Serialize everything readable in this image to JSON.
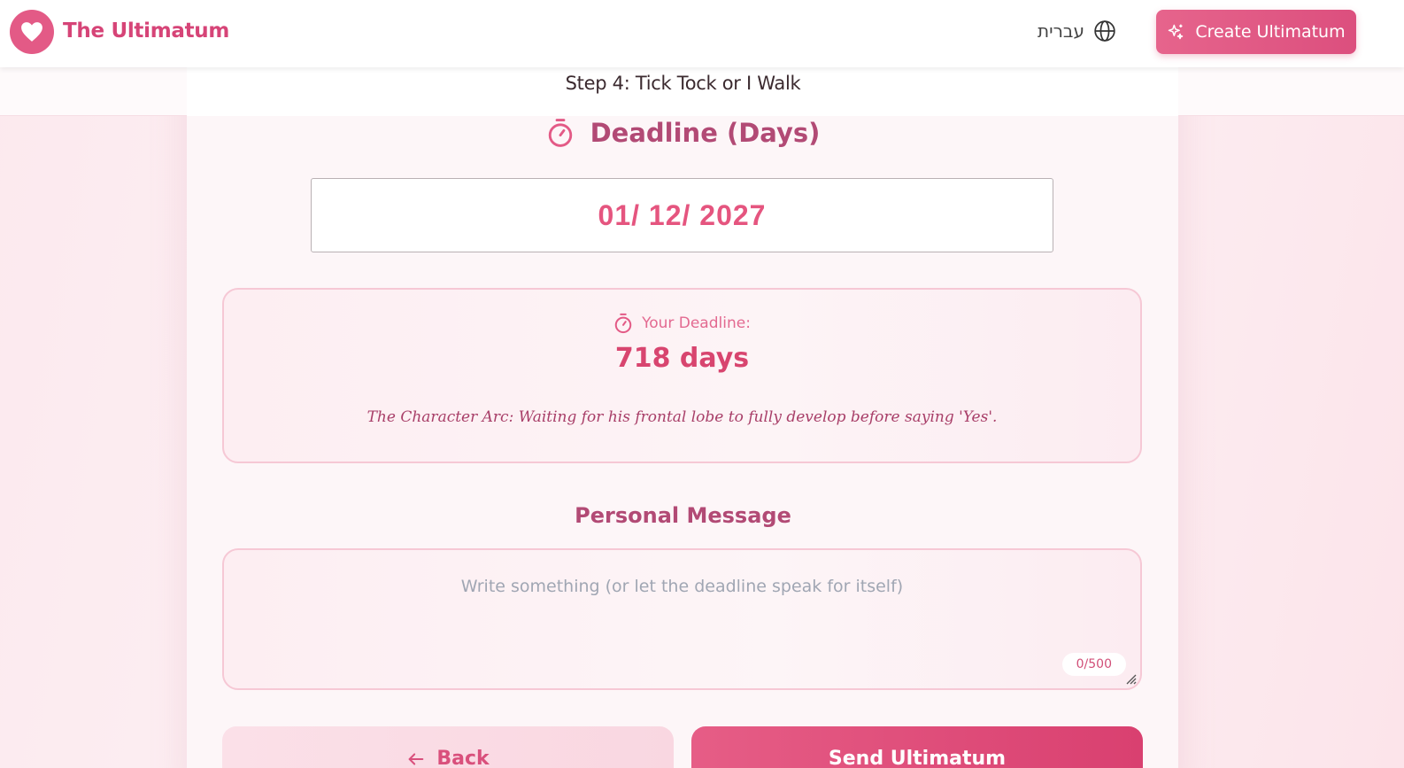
{
  "header": {
    "brand": "The Ultimatum",
    "language_label": "עברית",
    "create_button": "Create Ultimatum"
  },
  "step": {
    "title": "Step 4: Tick Tock or I Walk"
  },
  "deadline": {
    "heading": "Deadline (Days)",
    "date_value": "01/ 12/ 2027",
    "your_deadline_label": "Your Deadline:",
    "days_value": "718 days",
    "description": "The Character Arc: Waiting for his frontal lobe to fully develop before saying 'Yes'."
  },
  "message": {
    "heading": "Personal Message",
    "placeholder": "Write something (or let the deadline speak for itself)",
    "value": "",
    "counter": "0/500"
  },
  "actions": {
    "back_label": "Back",
    "send_label": "Send Ultimatum"
  },
  "colors": {
    "brand": "#d64477",
    "accent": "#e35a86",
    "heading": "#b24a75"
  },
  "icons": {
    "logo": "heart-icon",
    "language": "globe-icon",
    "create": "sparkles-icon",
    "deadline": "timer-icon",
    "back": "arrow-left-icon"
  }
}
